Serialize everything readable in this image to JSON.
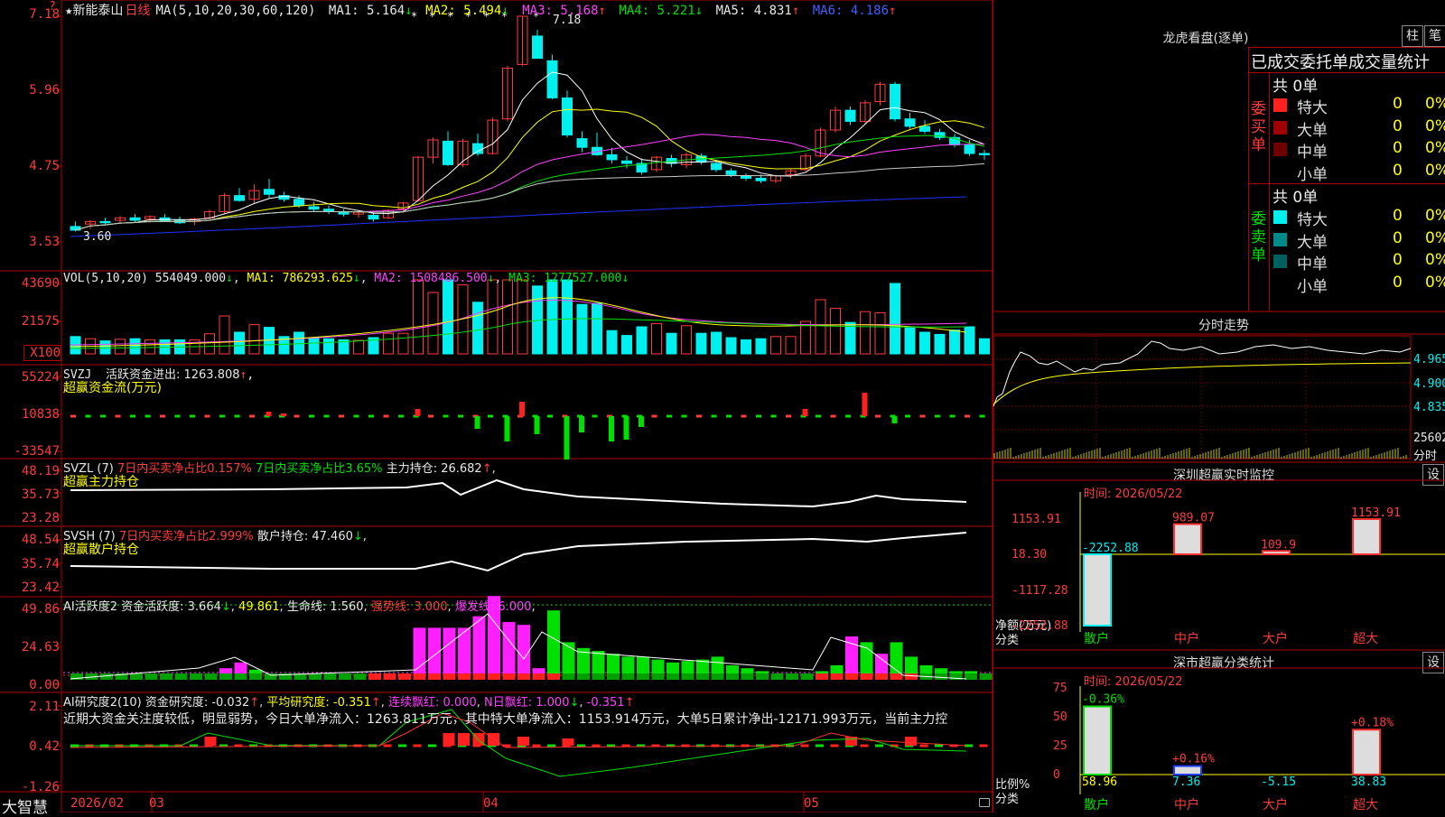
{
  "colors": {
    "up": "#ff3b3b",
    "down": "#00f0f0",
    "ma1": "#ffffff",
    "ma2": "#ffff00",
    "ma3": "#ff40ff",
    "ma4": "#00e000",
    "ma5": "#c8c8c8",
    "ma6": "#2030ff",
    "grid": "#b00000"
  },
  "header": {
    "star_icon": "star-icon",
    "stock_name": "新能泰山",
    "period": "日线",
    "ma_def": "MA(5,10,20,30,60,120)",
    "ma": [
      {
        "label": "MA1: 5.164",
        "arrow": "↓"
      },
      {
        "label": "MA2: 5.494",
        "arrow": "↓"
      },
      {
        "label": "MA3: 5.168",
        "arrow": "↑"
      },
      {
        "label": "MA4: 5.221",
        "arrow": "↓"
      },
      {
        "label": "MA5: 4.831",
        "arrow": "↑"
      },
      {
        "label": "MA6: 4.186",
        "arrow": "↑"
      }
    ],
    "peak_label": "7.18",
    "low_label": "3.60"
  },
  "axes": {
    "price": [
      "7.18",
      "5.96",
      "4.75",
      "3.53"
    ],
    "vol": [
      "43690",
      "21575",
      "X100"
    ],
    "svzj": [
      "55224",
      "10838",
      "-33547"
    ],
    "svzl": [
      "48.19",
      "35.73",
      "23.28"
    ],
    "svsh": [
      "48.54",
      "35.74",
      "23.42"
    ],
    "ai2": [
      "49.86",
      "24.63",
      "0.00"
    ],
    "ai_res": [
      "2.11",
      "0.42",
      "-1.26"
    ]
  },
  "vol_header": {
    "def": "VOL(5,10,20)",
    "v": "554049.000",
    "v_arrow": "↓",
    "ma1": "MA1: 786293.625",
    "ma1_arrow": "↓",
    "ma2": "MA2: 1508486.500",
    "ma2_arrow": "↓",
    "ma3": "MA3: 1277527.000",
    "ma3_arrow": "↓"
  },
  "svzj_header": {
    "name": "SVZJ",
    "label": "活跃资金进出: 1263.808",
    "arrow": "↑",
    "suffix": ",",
    "sub": "超赢资金流(万元)"
  },
  "svzl_header": {
    "name": "SVZL (7)",
    "p1": "7日内买卖净占比0.157%",
    "p2": "7日内买卖净占比3.65%",
    "p3": "主力持仓: 26.682",
    "arrow": "↑",
    "suffix": ",",
    "sub": "超赢主力持仓"
  },
  "svsh_header": {
    "name": "SVSH (7)",
    "p1": "7日内买卖净占比2.999%",
    "p3": "散户持仓: 47.460",
    "arrow": "↓",
    "suffix": ",",
    "sub": "超赢散户持仓"
  },
  "ai2_header": {
    "name": "AI活跃度2",
    "p1": "资金活跃度: 3.664",
    "a1": "↓",
    "p2": "49.861",
    "p3": "生命线: 1.560",
    "p4": "强势线: 3.000",
    "p5": "爆发线: 6.000",
    "suffix": ","
  },
  "ai_res_header": {
    "name": "AI研究度2(10)",
    "p1": "资金研究度: -0.032",
    "a1": "↑",
    "p2": "平均研究度: -0.351",
    "a2": "↑",
    "p3": "连续飘红: 0.000",
    "p4": "N日飘红: 1.000",
    "a4": "↓",
    "p5": "-0.351",
    "a5": "↑",
    "comment": "近期大资金关注度较低，明显弱势，今日大单净流入：1263.811万元，其中特大单净流入：1153.914万元，大单5日累计净出-12171.993万元，当前主力控"
  },
  "bottom": {
    "brand": "大智慧",
    "dates": [
      "2026/02",
      "03",
      "04",
      "05"
    ]
  },
  "right": {
    "lh_title": "龙虎看盘(逐单)",
    "btn_col": "柱",
    "btn_pen": "笔",
    "stat_title": "已成交委托单成交量统计",
    "buy_side": "委买单",
    "sell_side": "委卖单",
    "buy_total": "共 0单",
    "sell_total": "共 0单",
    "buy_rows": [
      {
        "name": "特大",
        "v": "0",
        "p": "0%",
        "color": "#ff2020"
      },
      {
        "name": "大单",
        "v": "0",
        "p": "0%",
        "color": "#a00000"
      },
      {
        "name": "中单",
        "v": "0",
        "p": "0%",
        "color": "#700000"
      },
      {
        "name": "小单",
        "v": "0",
        "p": "0%",
        "color": "#000000"
      }
    ],
    "sell_rows": [
      {
        "name": "特大",
        "v": "0",
        "p": "0%",
        "color": "#00f0f0"
      },
      {
        "name": "大单",
        "v": "0",
        "p": "0%",
        "color": "#008a8a"
      },
      {
        "name": "中单",
        "v": "0",
        "p": "0%",
        "color": "#006060"
      },
      {
        "name": "小单",
        "v": "0",
        "p": "0%",
        "color": "#000000"
      }
    ],
    "fs_title": "分时走势",
    "fs_prices": [
      "4.965",
      "4.900",
      "4.835"
    ],
    "fs_vol": "25602",
    "fs_label": "分时",
    "mon_title": "深圳超赢实时监控",
    "mon_btn": "设",
    "mon_time": "时间: 2026/05/22",
    "mon_axis": [
      "1153.91",
      "18.30",
      "-1117.28",
      "-2252.88"
    ],
    "mon_unit": "净额(万元)",
    "mon_cat": "分类",
    "mon_cats": [
      "散户",
      "中户",
      "大户",
      "超大"
    ],
    "mon_vals": [
      -2252.88,
      989.07,
      109.9,
      1153.91
    ],
    "mon_val_labels": [
      "-2252.88",
      "989.07",
      "109.9",
      "1153.91"
    ],
    "cls_title": "深市超赢分类统计",
    "cls_btn": "设",
    "cls_time": "时间: 2026/05/22",
    "cls_axis": [
      "75",
      "50",
      "25",
      "0"
    ],
    "cls_unit": "比例%",
    "cls_cat": "分类",
    "cls_cats": [
      "散户",
      "中户",
      "大户",
      "超大"
    ],
    "cls_vals": [
      58.96,
      7.36,
      -5.15,
      38.83
    ],
    "cls_val_labels": [
      "58.96",
      "7.36",
      "-5.15",
      "38.83"
    ],
    "cls_chg": [
      "-0.36%",
      "+0.16%",
      "",
      "+0.18%"
    ]
  },
  "chart_data": {
    "type": "candlestick",
    "candles": [
      [
        3.78,
        3.86,
        3.7,
        3.72
      ],
      [
        3.82,
        3.88,
        3.74,
        3.86
      ],
      [
        3.86,
        3.92,
        3.8,
        3.84
      ],
      [
        3.88,
        3.95,
        3.82,
        3.92
      ],
      [
        3.92,
        3.98,
        3.84,
        3.88
      ],
      [
        3.9,
        3.96,
        3.84,
        3.94
      ],
      [
        3.92,
        3.98,
        3.86,
        3.88
      ],
      [
        3.88,
        3.94,
        3.82,
        3.84
      ],
      [
        3.86,
        3.92,
        3.8,
        3.9
      ],
      [
        3.92,
        4.05,
        3.88,
        4.02
      ],
      [
        4.02,
        4.32,
        3.98,
        4.28
      ],
      [
        4.28,
        4.4,
        4.18,
        4.2
      ],
      [
        4.22,
        4.46,
        4.16,
        4.36
      ],
      [
        4.38,
        4.55,
        4.24,
        4.3
      ],
      [
        4.28,
        4.34,
        4.18,
        4.22
      ],
      [
        4.22,
        4.28,
        4.08,
        4.12
      ],
      [
        4.1,
        4.18,
        4.02,
        4.06
      ],
      [
        4.06,
        4.12,
        3.98,
        4.02
      ],
      [
        4.02,
        4.06,
        3.94,
        3.98
      ],
      [
        3.98,
        4.04,
        3.92,
        4.01
      ],
      [
        3.96,
        4.0,
        3.86,
        3.9
      ],
      [
        3.92,
        4.06,
        3.9,
        4.04
      ],
      [
        4.06,
        4.18,
        4.0,
        4.16
      ],
      [
        4.2,
        4.92,
        4.18,
        4.9
      ],
      [
        4.9,
        5.22,
        4.8,
        5.18
      ],
      [
        5.16,
        5.32,
        4.76,
        4.78
      ],
      [
        4.78,
        5.2,
        4.74,
        5.16
      ],
      [
        5.12,
        5.28,
        4.92,
        4.96
      ],
      [
        4.96,
        5.54,
        4.94,
        5.5
      ],
      [
        5.52,
        6.38,
        5.48,
        6.34
      ],
      [
        6.4,
        7.18,
        6.38,
        7.18
      ],
      [
        6.86,
        6.96,
        6.5,
        6.5
      ],
      [
        6.46,
        6.56,
        5.84,
        5.86
      ],
      [
        5.86,
        5.98,
        5.22,
        5.26
      ],
      [
        5.2,
        5.32,
        4.98,
        5.06
      ],
      [
        5.06,
        5.3,
        4.92,
        4.94
      ],
      [
        4.94,
        5.05,
        4.8,
        4.86
      ],
      [
        4.84,
        4.92,
        4.72,
        4.8
      ],
      [
        4.8,
        4.88,
        4.62,
        4.66
      ],
      [
        4.7,
        4.92,
        4.66,
        4.9
      ],
      [
        4.88,
        4.94,
        4.74,
        4.8
      ],
      [
        4.78,
        4.98,
        4.72,
        4.94
      ],
      [
        4.92,
        4.96,
        4.78,
        4.82
      ],
      [
        4.8,
        4.86,
        4.66,
        4.7
      ],
      [
        4.68,
        4.72,
        4.58,
        4.62
      ],
      [
        4.6,
        4.64,
        4.52,
        4.56
      ],
      [
        4.56,
        4.62,
        4.48,
        4.52
      ],
      [
        4.52,
        4.62,
        4.48,
        4.6
      ],
      [
        4.62,
        4.72,
        4.56,
        4.68
      ],
      [
        4.7,
        4.96,
        4.68,
        4.92
      ],
      [
        4.92,
        5.38,
        4.9,
        5.34
      ],
      [
        5.34,
        5.72,
        5.3,
        5.66
      ],
      [
        5.66,
        5.72,
        5.42,
        5.48
      ],
      [
        5.48,
        5.82,
        5.44,
        5.78
      ],
      [
        5.8,
        6.12,
        5.74,
        6.08
      ],
      [
        6.08,
        6.12,
        5.48,
        5.52
      ],
      [
        5.52,
        5.62,
        5.36,
        5.4
      ],
      [
        5.4,
        5.5,
        5.28,
        5.32
      ],
      [
        5.3,
        5.36,
        5.18,
        5.22
      ],
      [
        5.22,
        5.28,
        5.06,
        5.1
      ],
      [
        5.1,
        5.18,
        4.92,
        4.96
      ],
      [
        4.96,
        5.02,
        4.86,
        4.94
      ]
    ]
  }
}
